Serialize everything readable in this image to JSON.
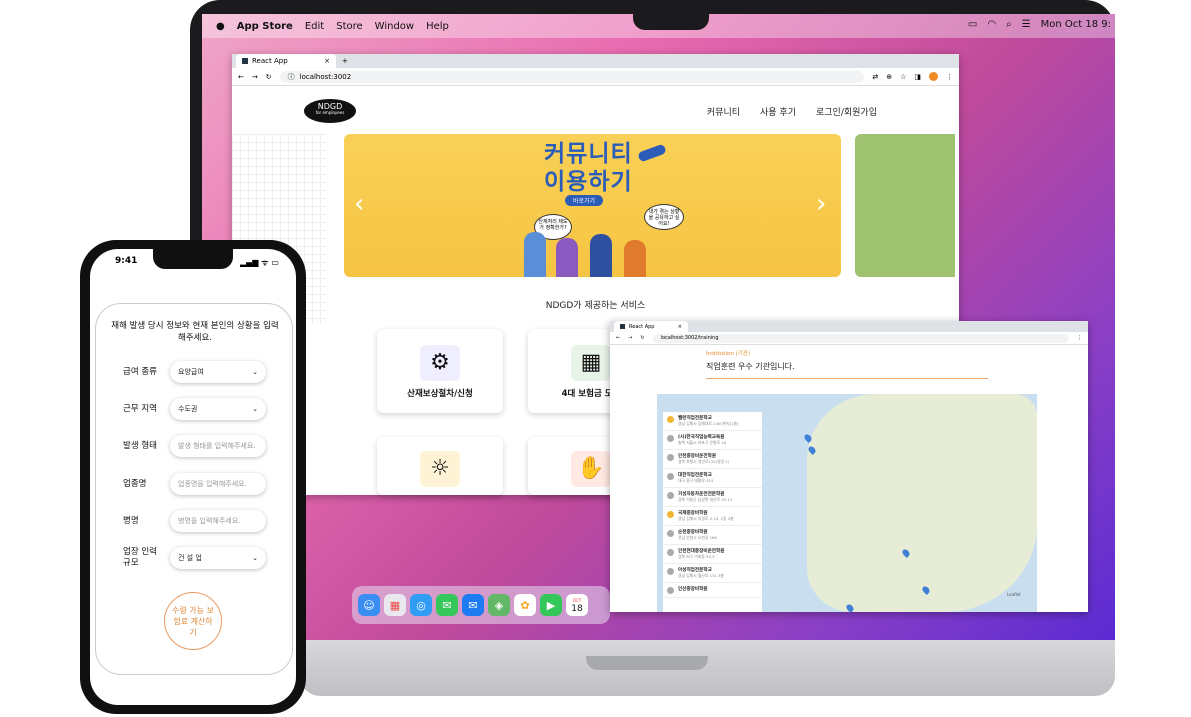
{
  "menubar": {
    "apple": "",
    "app": "App Store",
    "items": [
      "Edit",
      "Store",
      "Window",
      "Help"
    ],
    "clock": "Mon Oct 18 9:"
  },
  "browser": {
    "tab_title": "React App",
    "tab_add": "+",
    "url": "localhost:3002"
  },
  "site": {
    "logo": "NDGD",
    "logo_sub": "for employees",
    "nav": [
      "커뮤니티",
      "사용 후기",
      "로그인/회원가입"
    ],
    "banner": {
      "title_line1": "커뮤니티",
      "title_line2": "이용하기",
      "pill": "바로가기",
      "bubble1": "산재처리 제도가 정확한가?",
      "bubble2": "내가 겪는 상황을 공유하고 싶어요!"
    },
    "section_title": "NDGD가 제공하는 서비스",
    "cards": [
      {
        "label": "산재보상절차/신청",
        "icon": "claim-process-icon"
      },
      {
        "label": "4대 보험금 모의",
        "icon": "insurance-calculator-icon"
      },
      {
        "label": "",
        "icon": "idea-icon"
      },
      {
        "label": "",
        "icon": "care-hand-icon"
      }
    ]
  },
  "dock": {
    "calendar_month": "OCT",
    "calendar_day": "18"
  },
  "browser2": {
    "tab_title": "React App",
    "url": "localhost:3002/training",
    "inst_small": "Institution (기관)",
    "inst_main": "직업훈련 우수 기관입니다.",
    "list": [
      {
        "name": "밸런직업전문학교",
        "addr": "경남 김해시 김해대로 2400번지(1층)",
        "gold": true
      },
      {
        "name": "(사)한국직업능력교육원",
        "addr": "충북 서울시 마포구 은평로 18",
        "gold": false
      },
      {
        "name": "인천중장비운전학원",
        "addr": "경북 포항시 경안로132(영일 2)",
        "gold": false
      },
      {
        "name": "대한직업전문학교",
        "addr": "대구 중구 태평로 414",
        "gold": false
      },
      {
        "name": "거성자동차운전전문학원",
        "addr": "경북 거창군 남상면 대산로 33-12",
        "gold": false
      },
      {
        "name": "국제중장비학원",
        "addr": "경남 김해시 의생로 2-19, 1동 4층",
        "gold": true
      },
      {
        "name": "순천중장비학원",
        "addr": "전남 순천시 오천길 168",
        "gold": false
      },
      {
        "name": "인천현대중장비운전학원",
        "addr": "경북 서구 가좌동 55-5",
        "gold": false
      },
      {
        "name": "아성직업전문학교",
        "addr": "경남 김해시 월산로 131 3층",
        "gold": false
      },
      {
        "name": "인산중장비학원",
        "addr": "",
        "gold": false
      }
    ],
    "map_attribution": "Leaflet"
  },
  "phone": {
    "time": "9:41",
    "status": "▂▄▆ ᯤ ▭",
    "header": "재해 발생 당시 정보와 현재 본인의 상황을 입력해주세요.",
    "fields": [
      {
        "label": "급여 종류",
        "value": "요양급여",
        "placeholder": "",
        "select": true
      },
      {
        "label": "근무 지역",
        "value": "수도권",
        "placeholder": "",
        "select": true
      },
      {
        "label": "발생 형태",
        "value": "",
        "placeholder": "발생 형태를 입력해주세요.",
        "select": false
      },
      {
        "label": "업종명",
        "value": "",
        "placeholder": "업종명을 입력해주세요.",
        "select": false
      },
      {
        "label": "병명",
        "value": "",
        "placeholder": "병명을 입력해주세요.",
        "select": false
      },
      {
        "label": "업장 인력 규모",
        "value": "건 설 업",
        "placeholder": "",
        "select": true
      }
    ],
    "submit": "수령 가능 보험료 계산하기"
  }
}
